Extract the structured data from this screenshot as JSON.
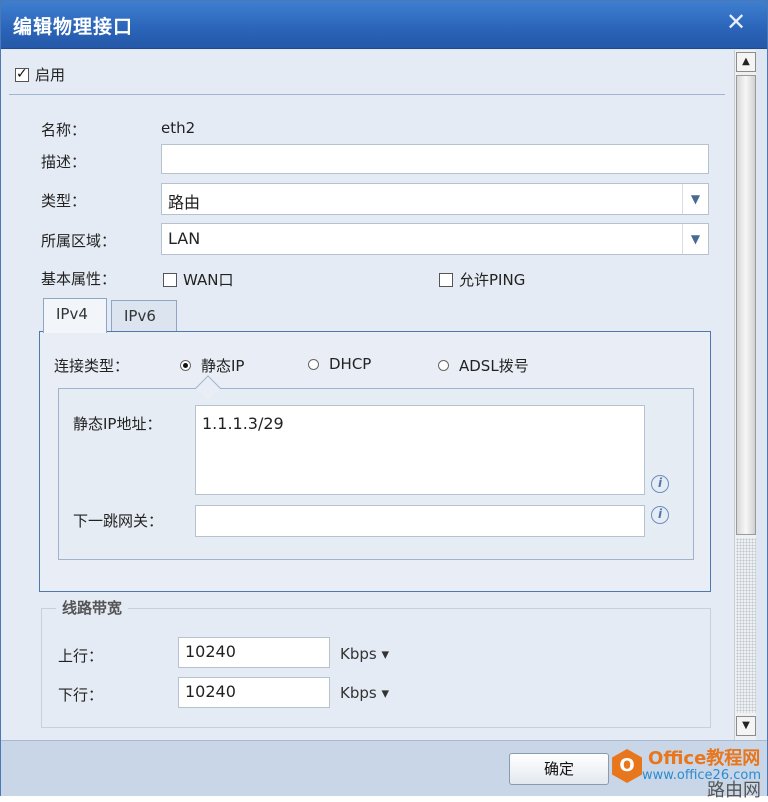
{
  "dialog": {
    "title": "编辑物理接口",
    "close_symbol": "✕"
  },
  "enable": {
    "label": "启用",
    "checked": true
  },
  "fields": {
    "name_label": "名称：",
    "name_value": "eth2",
    "desc_label": "描述：",
    "desc_value": "",
    "type_label": "类型：",
    "type_value": "路由",
    "zone_label": "所属区域：",
    "zone_value": "LAN",
    "basic_label": "基本属性：",
    "wan_label": "WAN口",
    "wan_checked": false,
    "ping_label": "允许PING",
    "ping_checked": false
  },
  "tabs": [
    {
      "label": "IPv4",
      "active": true
    },
    {
      "label": "IPv6",
      "active": false
    }
  ],
  "ipv4": {
    "conn_type_label": "连接类型：",
    "options": [
      {
        "label": "静态IP",
        "checked": true
      },
      {
        "label": "DHCP",
        "checked": false
      },
      {
        "label": "ADSL拨号",
        "checked": false
      }
    ],
    "static_ip_label": "静态IP地址：",
    "static_ip_value": "1.1.1.3/29",
    "gateway_label": "下一跳网关：",
    "gateway_value": ""
  },
  "bandwidth": {
    "legend": "线路带宽",
    "up_label": "上行：",
    "up_value": "10240",
    "up_unit": "Kbps ▾",
    "down_label": "下行：",
    "down_value": "10240",
    "down_unit": "Kbps ▾"
  },
  "footer": {
    "ok_label": "确定",
    "watermark_title": "Office教程网",
    "watermark_sub": "www.office26.com",
    "corner_text": "路由网"
  },
  "colors": {
    "title_bar": "#2a64b8",
    "panel_bg": "#e4ebf4",
    "watermark_orange": "#e8761c"
  }
}
